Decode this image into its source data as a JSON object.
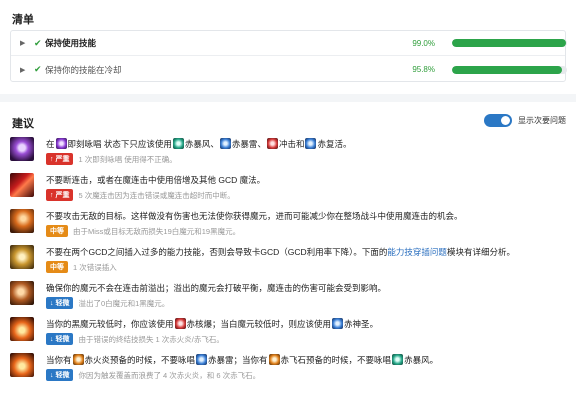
{
  "checklist": {
    "title": "清单",
    "items": [
      {
        "label": "保持使用技能",
        "percent": "99.0%",
        "fill": 0.99
      },
      {
        "label": "保持你的技能在冷却",
        "percent": "95.8%",
        "fill": 0.958
      }
    ]
  },
  "suggestions": {
    "title": "建议",
    "toggle_label": "显示次要问题",
    "items": [
      {
        "icon": "triplecast-icon",
        "parts": [
          "在",
          "即刻咏唱 状态下只应该使用",
          "赤暴风",
          "、",
          "赤暴雷",
          "、",
          "冲击",
          "和",
          "赤复活",
          "。"
        ],
        "severity": "严重",
        "severity_arrow": "↑",
        "detail": "1 次即刻咏唱 使用得不正确。"
      },
      {
        "icon": "manafication-icon",
        "text": "不要断连击，或者在魔连击中使用倍增及其他 GCD 魔法。",
        "severity": "严重",
        "severity_arrow": "↑",
        "detail": "5 次魔连击因为连击错误或魔连击超时而中断。"
      },
      {
        "icon": "verflare-icon",
        "text": "不要攻击无敌的目标。这样做没有伤害也无法使你获得魔元，进而可能减少你在整场战斗中使用魔连击的机会。",
        "severity": "中等",
        "severity_arrow": "↑",
        "detail": "由于Miss或目标无敌而损失19白魔元和19黑魔元。"
      },
      {
        "icon": "fleche-icon",
        "parts_a": "不要在两个GCD之间插入过多的能力技能，否则会导致卡GCD（GCD利用率下降）。下面的",
        "link": "能力技穿插问题",
        "parts_b": "模块有详细分析。",
        "severity": "中等",
        "severity_arrow": "↑",
        "detail": "1 次错误插入"
      },
      {
        "icon": "balance-icon",
        "text": "确保你的魔元不会在连击前溢出；溢出的魔元会打破平衡，魔连击的伤害可能会受到影响。",
        "severity": "轻微",
        "severity_arrow": "↓",
        "detail": "溢出了0白魔元和1黑魔元。"
      },
      {
        "icon": "verfire-proc-icon",
        "parts": [
          "当你的黑魔元较低时，你应该使用",
          "赤核爆",
          "；当白魔元较低时，则应该使用",
          "赤神圣",
          "。"
        ],
        "severity": "轻微",
        "severity_arrow": "↓",
        "detail": "由于错误的终结技损失 1 次赤火炎/赤飞石。"
      },
      {
        "icon": "verstone-proc-icon",
        "parts": [
          "当你有",
          "赤火炎预备的时候，不要咏唱",
          "赤暴雷；当你有",
          "赤飞石预备的时候，不要咏唱",
          "赤暴风。"
        ],
        "severity": "轻微",
        "severity_arrow": "↓",
        "detail": "你因为触发覆盖而浪费了 4 次赤火炎，和 6 次赤飞石。"
      }
    ]
  }
}
